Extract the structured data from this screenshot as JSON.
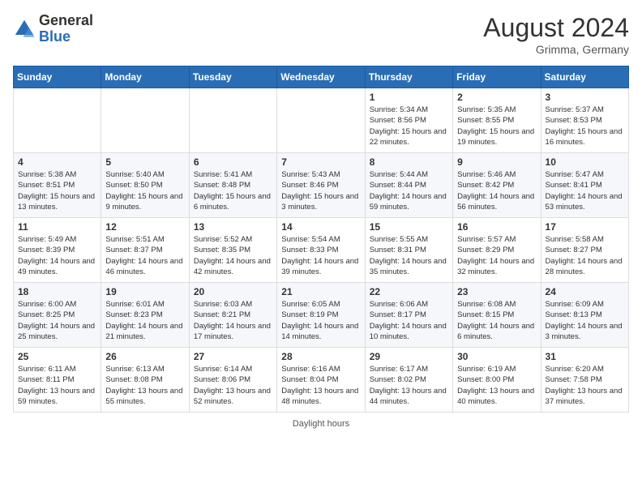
{
  "header": {
    "logo_general": "General",
    "logo_blue": "Blue",
    "month_year": "August 2024",
    "location": "Grimma, Germany"
  },
  "footer": {
    "note": "Daylight hours"
  },
  "days_of_week": [
    "Sunday",
    "Monday",
    "Tuesday",
    "Wednesday",
    "Thursday",
    "Friday",
    "Saturday"
  ],
  "weeks": [
    [
      {
        "day": "",
        "info": ""
      },
      {
        "day": "",
        "info": ""
      },
      {
        "day": "",
        "info": ""
      },
      {
        "day": "",
        "info": ""
      },
      {
        "day": "1",
        "info": "Sunrise: 5:34 AM\nSunset: 8:56 PM\nDaylight: 15 hours and 22 minutes."
      },
      {
        "day": "2",
        "info": "Sunrise: 5:35 AM\nSunset: 8:55 PM\nDaylight: 15 hours and 19 minutes."
      },
      {
        "day": "3",
        "info": "Sunrise: 5:37 AM\nSunset: 8:53 PM\nDaylight: 15 hours and 16 minutes."
      }
    ],
    [
      {
        "day": "4",
        "info": "Sunrise: 5:38 AM\nSunset: 8:51 PM\nDaylight: 15 hours and 13 minutes."
      },
      {
        "day": "5",
        "info": "Sunrise: 5:40 AM\nSunset: 8:50 PM\nDaylight: 15 hours and 9 minutes."
      },
      {
        "day": "6",
        "info": "Sunrise: 5:41 AM\nSunset: 8:48 PM\nDaylight: 15 hours and 6 minutes."
      },
      {
        "day": "7",
        "info": "Sunrise: 5:43 AM\nSunset: 8:46 PM\nDaylight: 15 hours and 3 minutes."
      },
      {
        "day": "8",
        "info": "Sunrise: 5:44 AM\nSunset: 8:44 PM\nDaylight: 14 hours and 59 minutes."
      },
      {
        "day": "9",
        "info": "Sunrise: 5:46 AM\nSunset: 8:42 PM\nDaylight: 14 hours and 56 minutes."
      },
      {
        "day": "10",
        "info": "Sunrise: 5:47 AM\nSunset: 8:41 PM\nDaylight: 14 hours and 53 minutes."
      }
    ],
    [
      {
        "day": "11",
        "info": "Sunrise: 5:49 AM\nSunset: 8:39 PM\nDaylight: 14 hours and 49 minutes."
      },
      {
        "day": "12",
        "info": "Sunrise: 5:51 AM\nSunset: 8:37 PM\nDaylight: 14 hours and 46 minutes."
      },
      {
        "day": "13",
        "info": "Sunrise: 5:52 AM\nSunset: 8:35 PM\nDaylight: 14 hours and 42 minutes."
      },
      {
        "day": "14",
        "info": "Sunrise: 5:54 AM\nSunset: 8:33 PM\nDaylight: 14 hours and 39 minutes."
      },
      {
        "day": "15",
        "info": "Sunrise: 5:55 AM\nSunset: 8:31 PM\nDaylight: 14 hours and 35 minutes."
      },
      {
        "day": "16",
        "info": "Sunrise: 5:57 AM\nSunset: 8:29 PM\nDaylight: 14 hours and 32 minutes."
      },
      {
        "day": "17",
        "info": "Sunrise: 5:58 AM\nSunset: 8:27 PM\nDaylight: 14 hours and 28 minutes."
      }
    ],
    [
      {
        "day": "18",
        "info": "Sunrise: 6:00 AM\nSunset: 8:25 PM\nDaylight: 14 hours and 25 minutes."
      },
      {
        "day": "19",
        "info": "Sunrise: 6:01 AM\nSunset: 8:23 PM\nDaylight: 14 hours and 21 minutes."
      },
      {
        "day": "20",
        "info": "Sunrise: 6:03 AM\nSunset: 8:21 PM\nDaylight: 14 hours and 17 minutes."
      },
      {
        "day": "21",
        "info": "Sunrise: 6:05 AM\nSunset: 8:19 PM\nDaylight: 14 hours and 14 minutes."
      },
      {
        "day": "22",
        "info": "Sunrise: 6:06 AM\nSunset: 8:17 PM\nDaylight: 14 hours and 10 minutes."
      },
      {
        "day": "23",
        "info": "Sunrise: 6:08 AM\nSunset: 8:15 PM\nDaylight: 14 hours and 6 minutes."
      },
      {
        "day": "24",
        "info": "Sunrise: 6:09 AM\nSunset: 8:13 PM\nDaylight: 14 hours and 3 minutes."
      }
    ],
    [
      {
        "day": "25",
        "info": "Sunrise: 6:11 AM\nSunset: 8:11 PM\nDaylight: 13 hours and 59 minutes."
      },
      {
        "day": "26",
        "info": "Sunrise: 6:13 AM\nSunset: 8:08 PM\nDaylight: 13 hours and 55 minutes."
      },
      {
        "day": "27",
        "info": "Sunrise: 6:14 AM\nSunset: 8:06 PM\nDaylight: 13 hours and 52 minutes."
      },
      {
        "day": "28",
        "info": "Sunrise: 6:16 AM\nSunset: 8:04 PM\nDaylight: 13 hours and 48 minutes."
      },
      {
        "day": "29",
        "info": "Sunrise: 6:17 AM\nSunset: 8:02 PM\nDaylight: 13 hours and 44 minutes."
      },
      {
        "day": "30",
        "info": "Sunrise: 6:19 AM\nSunset: 8:00 PM\nDaylight: 13 hours and 40 minutes."
      },
      {
        "day": "31",
        "info": "Sunrise: 6:20 AM\nSunset: 7:58 PM\nDaylight: 13 hours and 37 minutes."
      }
    ]
  ]
}
